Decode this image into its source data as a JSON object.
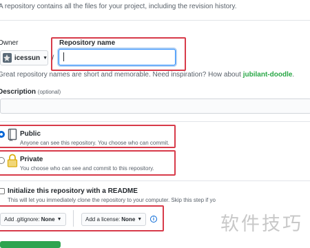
{
  "intro_text": "A repository contains all the files for your project, including the revision history.",
  "owner": {
    "label": "Owner",
    "value": "icessun"
  },
  "repo_name": {
    "label": "Repository name",
    "value": "",
    "placeholder": ""
  },
  "hint": {
    "text": "Great repository names are short and memorable. Need inspiration? How about ",
    "suggestion": "jubilant-doodle",
    "suffix": "."
  },
  "description": {
    "label": "Description",
    "optional": "(optional)",
    "value": ""
  },
  "visibility": {
    "public": {
      "title": "Public",
      "desc": "Anyone can see this repository. You choose who can commit.",
      "selected": true
    },
    "private": {
      "title": "Private",
      "desc": "You choose who can see and commit to this repository.",
      "selected": false
    }
  },
  "readme": {
    "title": "Initialize this repository with a README",
    "desc": "This will let you immediately clone the repository to your computer. Skip this step if yo"
  },
  "gitignore": {
    "label": "Add .gitignore:",
    "value": "None"
  },
  "license": {
    "label": "Add a license:",
    "value": "None"
  },
  "info_glyph": "i",
  "watermark": "软件技巧",
  "colors": {
    "highlight_box": "#d73a49",
    "focus_border": "#2188ff",
    "suggestion": "#28a745",
    "create_button": "#2ea44f"
  }
}
